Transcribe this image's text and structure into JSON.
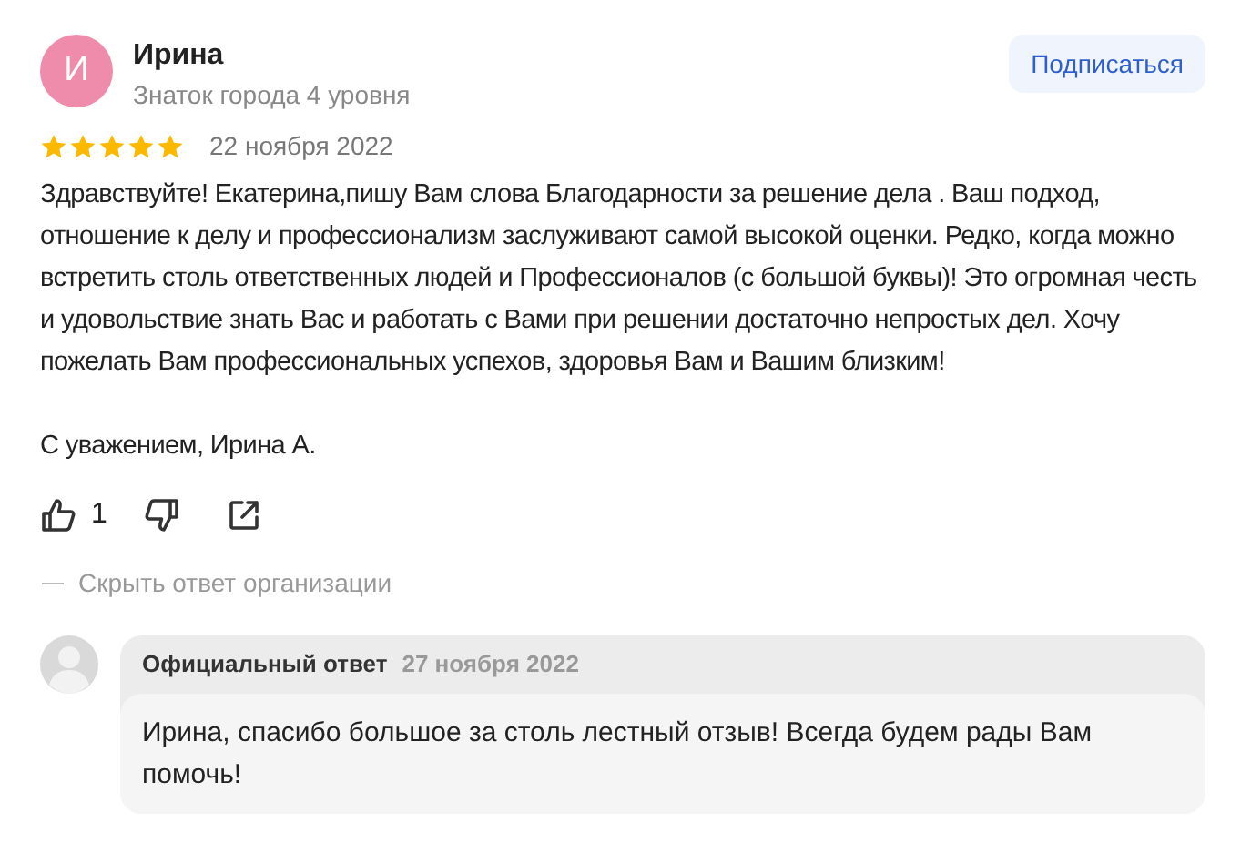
{
  "author": {
    "initial": "И",
    "name": "Ирина",
    "status": "Знаток города 4 уровня"
  },
  "subscribe_button": "Подписаться",
  "review": {
    "stars": 5,
    "date": "22 ноября 2022",
    "paragraphs": [
      "Здравствуйте! Екатерина,пишу Вам слова Благодарности за решение дела . Ваш подход, отношение к делу и профессионализм заслуживают самой высокой оценки. Редко, когда можно встретить столь ответственных людей и Профессионалов (с большой буквы)! Это огромная честь и удовольствие знать Вас и работать с Вами при решении достаточно непростых дел. Хочу пожелать Вам профессиональных успехов, здоровья Вам и Вашим близким!",
      "С уважением, Ирина А."
    ]
  },
  "likes": "1",
  "hide_reply_link": "Скрыть ответ организации",
  "reply": {
    "title": "Официальный ответ",
    "date": "27 ноября 2022",
    "text": "Ирина, спасибо большое за столь лестный отзыв! Всегда будем рады Вам помочь!"
  }
}
